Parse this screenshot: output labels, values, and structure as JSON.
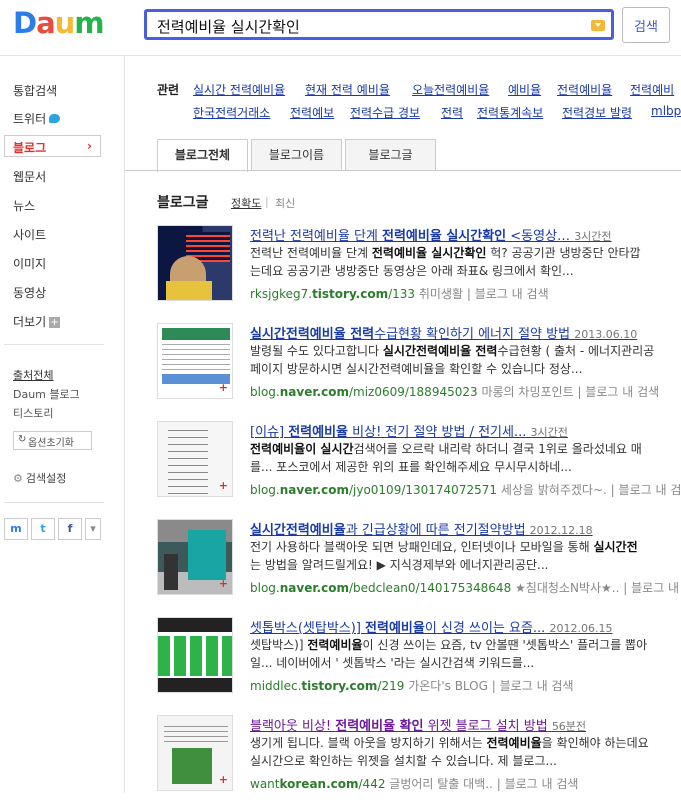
{
  "logo": {
    "letters": [
      "D",
      "a",
      "u",
      "m"
    ],
    "colors": [
      "#2b7de9",
      "#e94b3c",
      "#f5b935",
      "#25b24a"
    ]
  },
  "search": {
    "query": "전력예비율 실시간확인",
    "button": "검색",
    "icon": "keyboard-icon"
  },
  "sidebar": {
    "items": [
      "통합검색",
      "트위터",
      "블로그",
      "웹문서",
      "뉴스",
      "사이트",
      "이미지",
      "동영상",
      "더보기"
    ],
    "active_chevron": "›",
    "more_plus": "+",
    "sources": [
      "출처전체",
      "Daum 블로그",
      "티스토리"
    ],
    "reset": "옵션초기화",
    "settings": "검색설정",
    "share": {
      "mypeople": "m",
      "twitter": "t",
      "facebook": "f",
      "more": "▾"
    }
  },
  "related": {
    "title": "관련",
    "links": [
      "실시간 전력예비율",
      "현재 전력 예비율",
      "오늘전력예비율",
      "예비율",
      "전력예비율",
      "전력예비",
      "한국전력거래소",
      "전력예보",
      "전력수급 경보",
      "전력",
      "전력통계속보",
      "전력경보 발령",
      "mlbpar"
    ]
  },
  "tabs": [
    "블로그전체",
    "블로그이름",
    "블로그글"
  ],
  "section": {
    "title": "블로그글",
    "sort_accuracy": "정확도",
    "sort_divider": "|",
    "sort_recent": "최신"
  },
  "results": [
    {
      "title_a": "전력난 전력예비율 단계 ",
      "title_b": "전력예비율 실시간확인",
      "title_c": " <동영상…",
      "date": "3시간전",
      "l1a": "전력난 전력예비율 단계 ",
      "l1b": "전력예비율 실시간확인",
      "l1c": " 헉? 공공기관 냉방중단 안타깝",
      "l2": "는데요 공공기관 냉방중단 동영상은 아래 좌표& 링크에서 확인...",
      "url_a": "rksjgkeg7.",
      "url_b": "tistory.com",
      "url_c": "/133",
      "author": "취미생활",
      "in_blog": "블로그 내 검색"
    },
    {
      "title_a": "",
      "title_b": "실시간전력예비율 전력",
      "title_c": "수급현황 확인하기 에너지 절약 방법",
      "date": "2013.06.10",
      "l1a": "발령될 수도 있다고합니다 ",
      "l1b": "실시간전력예비율 전력",
      "l1c": "수급현황 ( 출처 - 에너지관리공",
      "l2": "페이지 방문하시면 실시간전력예비율을 확인할 수 있습니다 정상...",
      "url_a": "blog.",
      "url_b": "naver.com",
      "url_c": "/miz0609/188945023",
      "author": "마롱의 차밍포인트",
      "in_blog": "블로그 내 검색"
    },
    {
      "title_a": "[이슈] ",
      "title_b": "전력예비율",
      "title_c": " 비상! 전기 절약 방법 / 전기세...",
      "date": "3시간전",
      "l1a": "",
      "l1b": "전력예비율이 실시간",
      "l1c": "검색어를 오르락 내리락 하더니 결국 1위로 올라섰네요 매",
      "l2": "를... 포스코에서 제공한 위의 표를 확인해주세요 무시무시하네...",
      "url_a": "blog.",
      "url_b": "naver.com",
      "url_c": "/jyo0109/130174072571",
      "author": "세상을 밝혀주겠다~.",
      "in_blog": "블로그 내 검색"
    },
    {
      "title_a": "",
      "title_b": "실시간전력예비율",
      "title_c": "과 긴급상황에 따른 전기절약방법",
      "date": "2012.12.18",
      "l1a": "전기 사용하다 블랙아웃 되면 낭패인데요, 인터넷이나 모바일을 통해 ",
      "l1b": "실시간전",
      "l1c": "",
      "l2": "는 방법을 알려드릴게요! ▶ 지식경제부와 에너지관리공단...",
      "url_a": "blog.",
      "url_b": "naver.com",
      "url_c": "/bedclean0/140175348648",
      "author": "★침대청소N박사★..",
      "in_blog": "블로그 내 검색"
    },
    {
      "title_a": "셋톱박스(셋탑박스)] ",
      "title_b": "전력예비율",
      "title_c": "이 신경 쓰이는 요즘...",
      "date": "2012.06.15",
      "l1a": "셋탑박스)] ",
      "l1b": "전력예비율",
      "l1c": "이 신경 쓰이는 요즘, tv 안볼땐 '셋톱박스' 플러그를 뽑아",
      "l2": "일... 네이버에서 ' 셋톱박스 '라는 실시간검색 키워드를...",
      "url_a": "middlec.",
      "url_b": "tistory.com",
      "url_c": "/219",
      "author": "가온다's BLOG",
      "in_blog": "블로그 내 검색"
    },
    {
      "title_a": "블랙아웃 비상! ",
      "title_b": "전력예비율 확인",
      "title_c": " 위젯 블로그 설치 방법",
      "date": "56분전",
      "l1a": "생기게 됩니다. 블랙 아웃을 방지하기 위해서는 ",
      "l1b": "전력예비율",
      "l1c": "을 확인해야 하는데요",
      "l2": "실시간으로 확인하는 위젯을 설치할 수 있습니다. 제 블로그...",
      "url_a": "want",
      "url_b": "korean.com",
      "url_c": "/442",
      "author": "글벙어리 탈출 대백..",
      "in_blog": "블로그 내 검색"
    }
  ]
}
